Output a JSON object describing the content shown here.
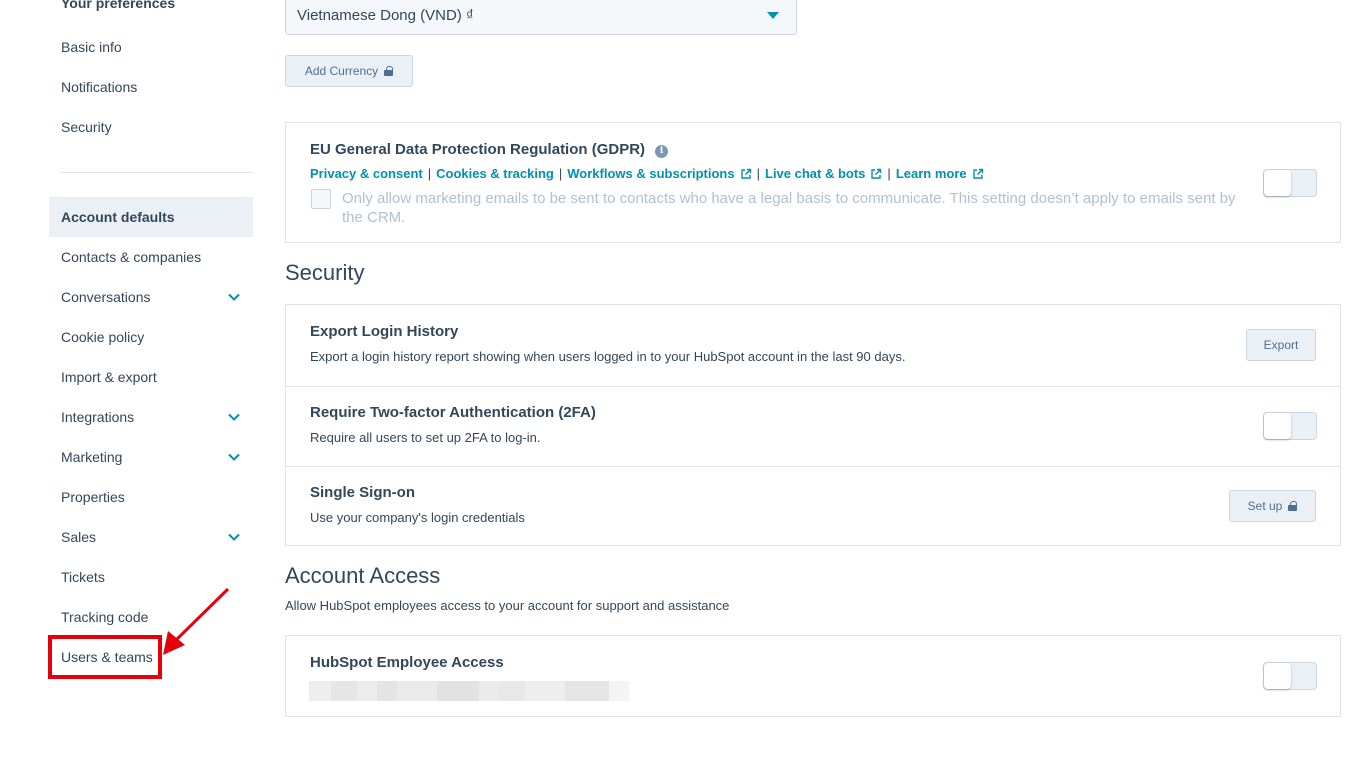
{
  "sidebar": {
    "heading": "Your preferences",
    "preference_items": [
      {
        "label": "Basic info"
      },
      {
        "label": "Notifications"
      },
      {
        "label": "Security"
      }
    ],
    "account_items": [
      {
        "label": "Account defaults",
        "active": true
      },
      {
        "label": "Contacts & companies"
      },
      {
        "label": "Conversations",
        "expandable": true
      },
      {
        "label": "Cookie policy"
      },
      {
        "label": "Import & export"
      },
      {
        "label": "Integrations",
        "expandable": true
      },
      {
        "label": "Marketing",
        "expandable": true
      },
      {
        "label": "Properties"
      },
      {
        "label": "Sales",
        "expandable": true
      },
      {
        "label": "Tickets"
      },
      {
        "label": "Tracking code"
      },
      {
        "label": "Users & teams",
        "highlighted": true
      }
    ]
  },
  "currency": {
    "selected": "Vietnamese Dong (VND) ₫",
    "add_button": "Add Currency"
  },
  "gdpr": {
    "title": "EU General Data Protection Regulation (GDPR)",
    "links": [
      "Privacy & consent",
      "Cookies & tracking",
      "Workflows & subscriptions",
      "Live chat & bots",
      "Learn more"
    ],
    "checkbox_label": "Only allow marketing emails to be sent to contacts who have a legal basis to communicate. This setting doesn’t apply to emails sent by the CRM."
  },
  "security": {
    "title": "Security",
    "rows": [
      {
        "title": "Export Login History",
        "description": "Export a login history report showing when users logged in to your HubSpot account in the last 90 days.",
        "button": "Export"
      },
      {
        "title": "Require Two-factor Authentication (2FA)",
        "description": "Require all users to set up 2FA to log-in."
      },
      {
        "title": "Single Sign-on",
        "description": "Use your company's login credentials",
        "button": "Set up"
      }
    ]
  },
  "account_access": {
    "title": "Account Access",
    "description": "Allow HubSpot employees access to your account for support and assistance",
    "row_title": "HubSpot Employee Access"
  },
  "colors": {
    "accent": "#0091ae",
    "text": "#33475b",
    "highlight": "#e5000c"
  }
}
